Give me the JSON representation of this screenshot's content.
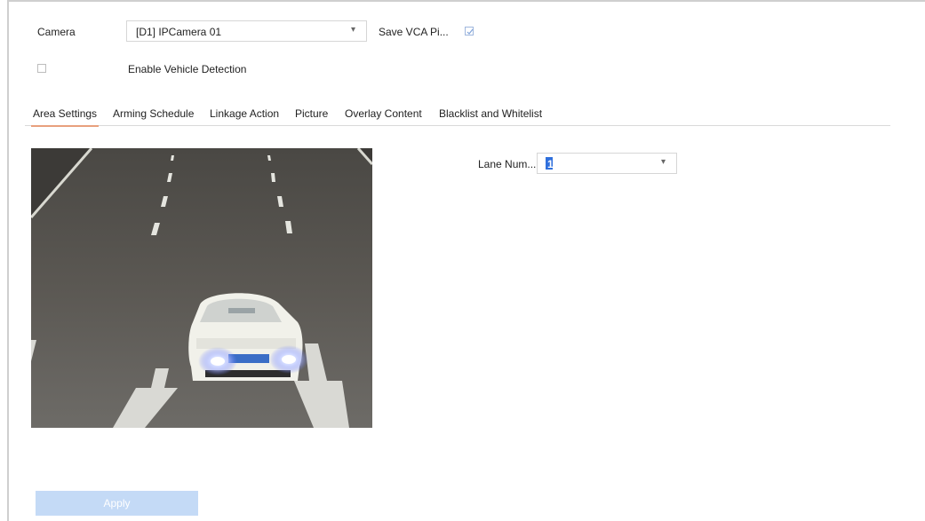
{
  "camera": {
    "label": "Camera",
    "selected": "[D1] IPCamera 01",
    "caret": "▾"
  },
  "save_vca": {
    "label": "Save VCA Pi...",
    "checked": true
  },
  "vehicle_detection": {
    "label": "Enable Vehicle Detection",
    "checked": false
  },
  "tabs": [
    {
      "label": "Area Settings",
      "active": true
    },
    {
      "label": "Arming Schedule",
      "active": false
    },
    {
      "label": "Linkage Action",
      "active": false
    },
    {
      "label": "Picture",
      "active": false
    },
    {
      "label": "Overlay Content",
      "active": false
    },
    {
      "label": "Blacklist and Whitelist",
      "active": false
    }
  ],
  "lane": {
    "label": "Lane Num...",
    "value": "1",
    "caret": "▾"
  },
  "apply_label": "Apply",
  "colors": {
    "accent_tab": "#e8a07d",
    "apply_bg": "#c4daf6",
    "selection": "#2f6fdc"
  }
}
